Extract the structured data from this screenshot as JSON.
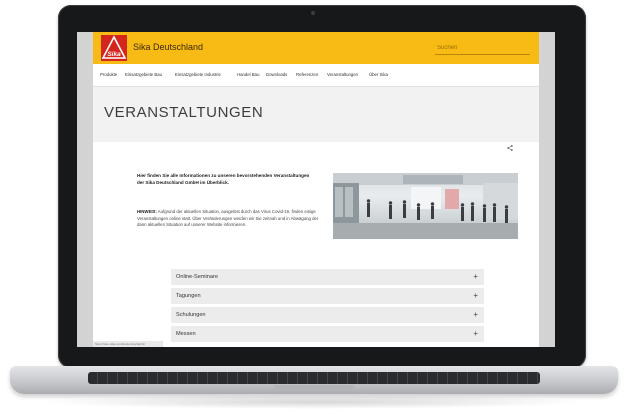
{
  "site": {
    "brand_name": "Sika Deutschland",
    "logo_text": "Sika",
    "search_placeholder": "Suchen",
    "nav": [
      {
        "label": "Produkte"
      },
      {
        "label": "Einsatzgebiete Bau"
      },
      {
        "label": "Einsatzgebiete Industrie"
      },
      {
        "label": "Handel Bau"
      },
      {
        "label": "Downloads"
      },
      {
        "label": "Referenzen"
      },
      {
        "label": "Veranstaltungen"
      },
      {
        "label": "Über Sika"
      }
    ],
    "page_title": "VERANSTALTUNGEN",
    "intro_text": "Hier finden Sie alle Informationen zu unseren bevorstehenden Veranstaltungen der Sika Deutschland GmbH im Überblick.",
    "notice_label": "HINWEIS:",
    "notice_text": " Aufgrund der aktuellen Situation, ausgelöst durch das Virus Covid-19, finden einige Veranstaltungen online statt. Über Veränderungen werden wir Sie zeitnah und in Abwägung der dann aktuellen Situation auf unserer Website informieren.",
    "accordion": [
      {
        "label": "Online-Seminare",
        "icon": "+"
      },
      {
        "label": "Tagungen",
        "icon": "+"
      },
      {
        "label": "Schulungen",
        "icon": "+"
      },
      {
        "label": "Messen",
        "icon": "+"
      }
    ],
    "status_url": "https://deu.sika.com/de/service/fachin"
  },
  "colors": {
    "brand_yellow": "#f8bb16",
    "logo_red": "#d5261e",
    "frame": "#17181a"
  }
}
